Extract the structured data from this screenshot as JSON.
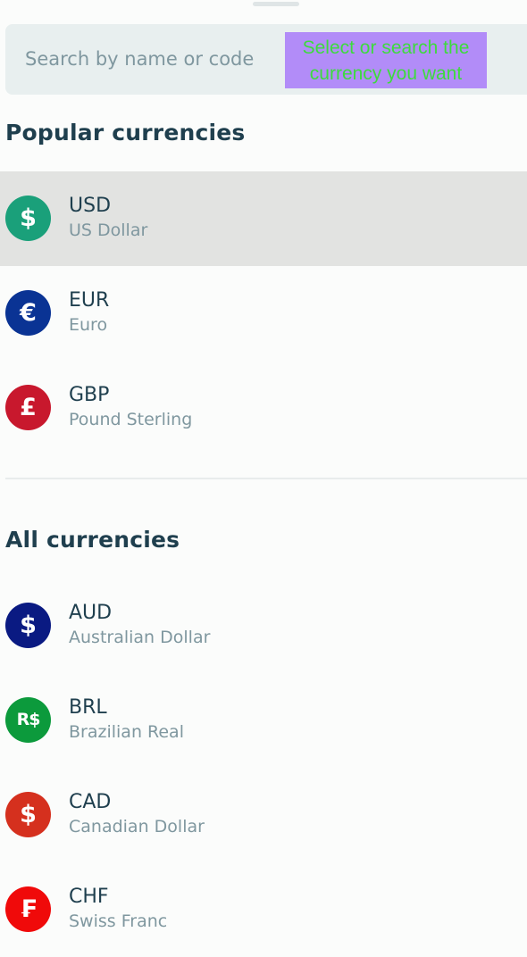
{
  "search": {
    "placeholder": "Search by name or code",
    "value": ""
  },
  "tooltip": {
    "text": "Select or search the currency you want",
    "background": "#b28cf8",
    "color": "#3ddb3d"
  },
  "popular": {
    "title": "Popular currencies",
    "items": [
      {
        "code": "USD",
        "name": "US Dollar",
        "symbol": "$",
        "color": "#1aa07a",
        "icon": "dollar-icon",
        "selected": true
      },
      {
        "code": "EUR",
        "name": "Euro",
        "symbol": "€",
        "color": "#0a3394",
        "icon": "euro-icon",
        "selected": false
      },
      {
        "code": "GBP",
        "name": "Pound Sterling",
        "symbol": "£",
        "color": "#c8182d",
        "icon": "pound-icon",
        "selected": false
      }
    ]
  },
  "all": {
    "title": "All currencies",
    "items": [
      {
        "code": "AUD",
        "name": "Australian Dollar",
        "symbol": "$",
        "color": "#0a1a82",
        "icon": "dollar-icon"
      },
      {
        "code": "BRL",
        "name": "Brazilian Real",
        "symbol": "R$",
        "color": "#0c9a3c",
        "icon": "real-icon"
      },
      {
        "code": "CAD",
        "name": "Canadian Dollar",
        "symbol": "$",
        "color": "#d5301e",
        "icon": "dollar-icon"
      },
      {
        "code": "CHF",
        "name": "Swiss Franc",
        "symbol": "₣",
        "color": "#f00a0a",
        "icon": "franc-icon"
      }
    ]
  },
  "colors": {
    "selected_row": "#e2e3e1",
    "primary_text": "#1f3f4e",
    "secondary_text": "#7f979f"
  }
}
